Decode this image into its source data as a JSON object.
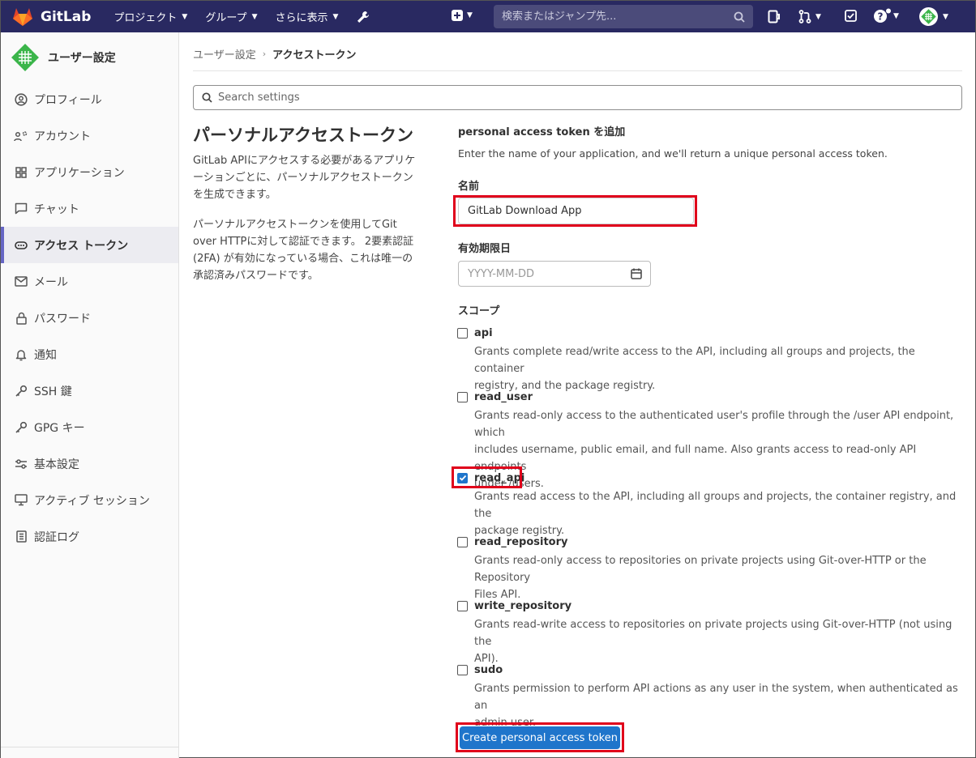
{
  "topbar": {
    "brand": "GitLab",
    "nav": [
      {
        "label": "プロジェクト"
      },
      {
        "label": "グループ"
      },
      {
        "label": "さらに表示"
      }
    ],
    "search_placeholder": "検索またはジャンプ先..."
  },
  "sidebar": {
    "title": "ユーザー設定",
    "items": [
      {
        "label": "プロフィール",
        "icon": "profile-icon"
      },
      {
        "label": "アカウント",
        "icon": "account-icon"
      },
      {
        "label": "アプリケーション",
        "icon": "applications-icon"
      },
      {
        "label": "チャット",
        "icon": "chat-icon"
      },
      {
        "label": "アクセス トークン",
        "icon": "token-icon",
        "active": true
      },
      {
        "label": "メール",
        "icon": "mail-icon"
      },
      {
        "label": "パスワード",
        "icon": "lock-icon"
      },
      {
        "label": "通知",
        "icon": "bell-icon"
      },
      {
        "label": "SSH 鍵",
        "icon": "key-icon"
      },
      {
        "label": "GPG キー",
        "icon": "key-icon"
      },
      {
        "label": "基本設定",
        "icon": "preferences-icon"
      },
      {
        "label": "アクティブ セッション",
        "icon": "monitor-icon"
      },
      {
        "label": "認証ログ",
        "icon": "log-icon"
      }
    ]
  },
  "breadcrumb": {
    "parent": "ユーザー設定",
    "current": "アクセストークン"
  },
  "settings_search": {
    "placeholder": "Search settings"
  },
  "left": {
    "title": "パーソナルアクセストークン",
    "p1_line1": "GitLab APIにアクセスする必要があるアプリケ",
    "p1_line2": "ーションごとに、パーソナルアクセストークン",
    "p1_line3": "を生成できます。",
    "p2_line1": "パーソナルアクセストークンを使用してGit",
    "p2_line2": "over HTTPに対して認証できます。 2要素認証",
    "p2_line3": "(2FA) が有効になっている場合、これは唯一の",
    "p2_line4": "承認済みパスワードです。"
  },
  "form": {
    "title": "personal access token を追加",
    "description": "Enter the name of your application, and we'll return a unique personal access token.",
    "name_label": "名前",
    "name_value": "GitLab Download App",
    "expiry_label": "有効期限日",
    "expiry_placeholder": "YYYY-MM-DD",
    "scopes_label": "スコープ",
    "submit_label": "Create personal access token"
  },
  "scopes": [
    {
      "name": "api",
      "checked": false,
      "desc1": "Grants complete read/write access to the API, including all groups and projects, the container",
      "desc2": "registry, and the package registry.",
      "desc3": ""
    },
    {
      "name": "read_user",
      "checked": false,
      "desc1": "Grants read-only access to the authenticated user's profile through the /user API endpoint, which",
      "desc2": "includes username, public email, and full name. Also grants access to read-only API endpoints",
      "desc3": "under /users."
    },
    {
      "name": "read_api",
      "checked": true,
      "desc1": "Grants read access to the API, including all groups and projects, the container registry, and the",
      "desc2": "package registry.",
      "desc3": ""
    },
    {
      "name": "read_repository",
      "checked": false,
      "desc1": "Grants read-only access to repositories on private projects using Git-over-HTTP or the Repository",
      "desc2": "Files API.",
      "desc3": ""
    },
    {
      "name": "write_repository",
      "checked": false,
      "desc1": "Grants read-write access to repositories on private projects using Git-over-HTTP (not using the",
      "desc2": "API).",
      "desc3": ""
    },
    {
      "name": "sudo",
      "checked": false,
      "desc1": "Grants permission to perform API actions as any user in the system, when authenticated as an",
      "desc2": "admin user.",
      "desc3": ""
    }
  ],
  "colors": {
    "topbar": "#292961",
    "primary_button": "#1f75cb",
    "highlight": "#e0001b",
    "active_indicator": "#6666c4"
  }
}
